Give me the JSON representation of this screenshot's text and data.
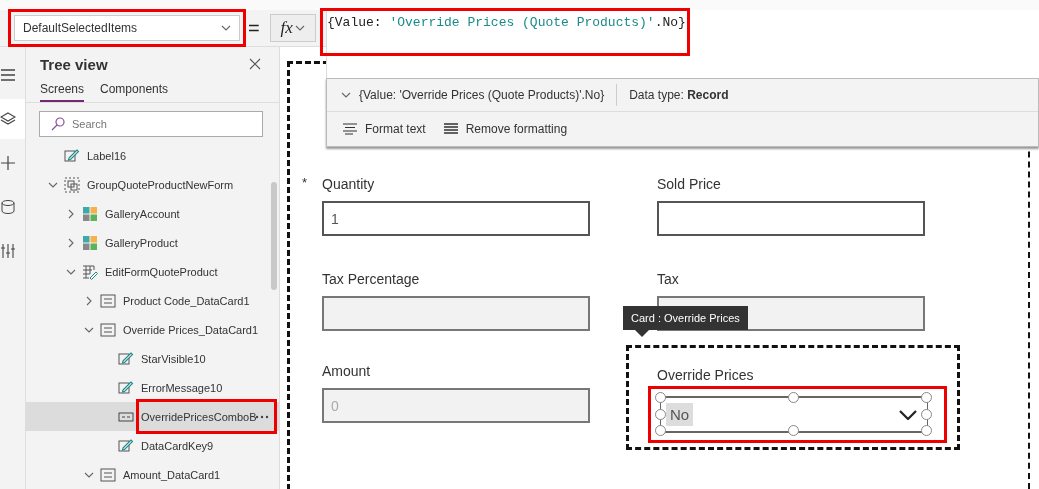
{
  "property_selector": {
    "value": "DefaultSelectedItems",
    "highlighted": true
  },
  "equals": "=",
  "fx_button": {
    "label": "fx"
  },
  "formula": {
    "highlighted": true,
    "segments": [
      {
        "text": "{Value: ",
        "kind": "plain"
      },
      {
        "text": "'Override Prices (Quote Products)'",
        "kind": "string"
      },
      {
        "text": ".No}",
        "kind": "plain"
      }
    ]
  },
  "formula_result": {
    "value": "{Value: 'Override Prices (Quote Products)'.No}",
    "data_type": "Data type: **Record**"
  },
  "format_actions": [
    {
      "label": "Format text",
      "kind": "format"
    },
    {
      "label": "Remove formatting",
      "kind": "remove"
    }
  ],
  "rail": [
    {
      "kind": "menu",
      "selected": false
    },
    {
      "kind": "layers",
      "selected": true
    },
    {
      "kind": "insert",
      "selected": false
    },
    {
      "kind": "data",
      "selected": false
    },
    {
      "kind": "tools",
      "selected": false
    }
  ],
  "tree_view": {
    "title": "Tree view",
    "tabs": [
      {
        "label": "Screens",
        "selected": true
      },
      {
        "label": "Components",
        "selected": false
      }
    ],
    "search": {
      "placeholder": "Search"
    },
    "items": [
      {
        "label": "Label16",
        "kind": "label",
        "selected": false
      },
      {
        "label": "GroupQuoteProductNewForm",
        "kind": "group",
        "expanded": true,
        "selected": false,
        "children": [
          {
            "label": "GalleryAccount",
            "kind": "gallery",
            "expanded": false,
            "selected": false
          },
          {
            "label": "GalleryProduct",
            "kind": "gallery",
            "expanded": false,
            "selected": false
          },
          {
            "label": "EditFormQuoteProduct",
            "kind": "form",
            "expanded": true,
            "selected": false,
            "children": [
              {
                "label": "Product Code_DataCard1",
                "kind": "card",
                "expanded": false,
                "selected": false
              },
              {
                "label": "Override Prices_DataCard1",
                "kind": "card",
                "expanded": true,
                "selected": false,
                "children": [
                  {
                    "label": "StarVisible10",
                    "kind": "label",
                    "selected": false
                  },
                  {
                    "label": "ErrorMessage10",
                    "kind": "label",
                    "selected": false
                  },
                  {
                    "label": "OverridePricesComboB",
                    "kind": "combobox",
                    "selected": true,
                    "highlighted": true
                  },
                  {
                    "label": "DataCardKey9",
                    "kind": "label",
                    "selected": false
                  }
                ]
              },
              {
                "label": "Amount_DataCard1",
                "kind": "card",
                "expanded": true,
                "selected": false
              }
            ]
          }
        ]
      }
    ]
  },
  "form": {
    "fields": [
      {
        "label": "Quantity",
        "value": "1",
        "required_mark": "*",
        "disabled": false
      },
      {
        "label": "Sold Price",
        "disabled": false
      },
      {
        "label": "Tax Percentage",
        "disabled": true
      },
      {
        "label": "Tax",
        "disabled": true
      },
      {
        "label": "Amount",
        "value": "0",
        "disabled": true
      }
    ],
    "selected_card": {
      "tooltip": "Card : Override Prices",
      "label": "Override Prices",
      "value": "No",
      "highlighted": true
    }
  }
}
